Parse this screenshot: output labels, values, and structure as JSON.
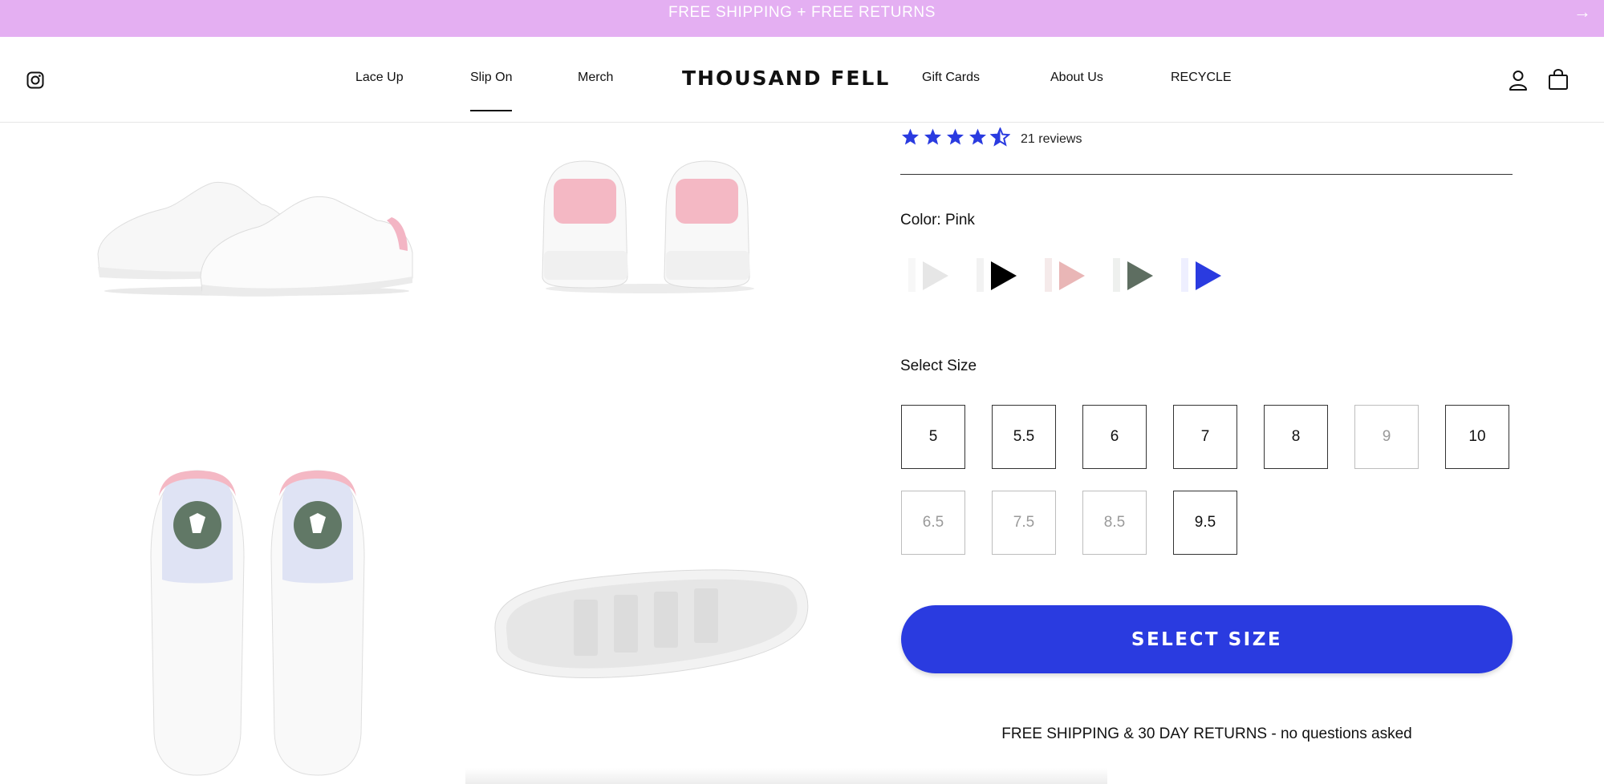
{
  "announcement": {
    "text": "FREE SHIPPING + FREE RETURNS",
    "arrow": "→"
  },
  "header": {
    "nav_left": [
      "Lace Up",
      "Slip On",
      "Merch"
    ],
    "logo": "THOUSAND FELL",
    "nav_right": [
      "Gift Cards",
      "About Us",
      "RECYCLE"
    ],
    "active_nav": "Slip On"
  },
  "product": {
    "rating": 4.5,
    "reviews_text": "21 reviews",
    "color_label": "Color: Pink",
    "colors": [
      {
        "name": "white",
        "hex": "#e6e6e6"
      },
      {
        "name": "black",
        "hex": "#000000"
      },
      {
        "name": "pink",
        "hex": "#e9b6b6"
      },
      {
        "name": "green",
        "hex": "#5e6e61"
      },
      {
        "name": "blue",
        "hex": "#2a3be0"
      }
    ],
    "size_label": "Select Size",
    "sizes": [
      {
        "label": "5",
        "available": true
      },
      {
        "label": "5.5",
        "available": true
      },
      {
        "label": "6",
        "available": true
      },
      {
        "label": "7",
        "available": true
      },
      {
        "label": "8",
        "available": true
      },
      {
        "label": "9",
        "available": false
      },
      {
        "label": "10",
        "available": true
      },
      {
        "label": "6.5",
        "available": false
      },
      {
        "label": "7.5",
        "available": false
      },
      {
        "label": "8.5",
        "available": false
      },
      {
        "label": "9.5",
        "available": true
      }
    ],
    "cta": "SELECT SIZE",
    "shipping_note": "FREE SHIPPING & 30 DAY RETURNS - no questions asked"
  },
  "theme": {
    "announcement_bg": "#e4aff2",
    "accent": "#2a3be0",
    "heel_pink": "#f4b8c4",
    "insole_badge": "#617866"
  }
}
